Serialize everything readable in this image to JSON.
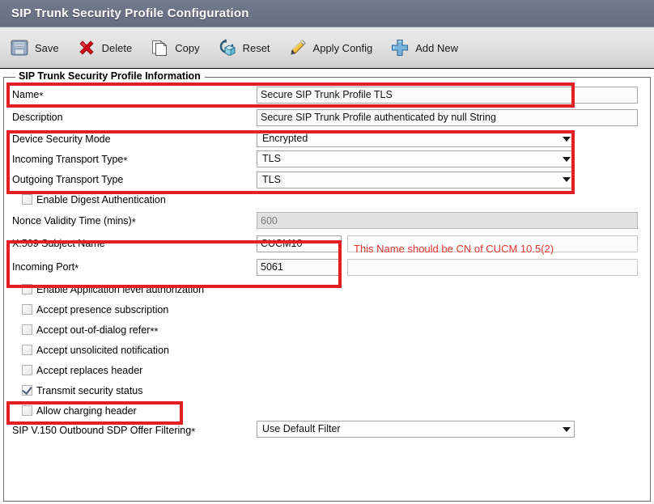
{
  "window": {
    "title": "SIP Trunk Security Profile Configuration",
    "titlebar_color": "#6b7487"
  },
  "toolbar": {
    "items": [
      {
        "label": "Save",
        "icon": "save-floppy-icon"
      },
      {
        "label": "Delete",
        "icon": "delete-x-icon"
      },
      {
        "label": "Copy",
        "icon": "copy-pages-icon"
      },
      {
        "label": "Reset",
        "icon": "reset-refresh-icon"
      },
      {
        "label": "Apply Config",
        "icon": "apply-config-pencil-icon"
      },
      {
        "label": "Add New",
        "icon": "add-new-plus-icon"
      }
    ]
  },
  "section": {
    "legend": "SIP Trunk Security Profile Information"
  },
  "fields": {
    "name": {
      "label": "Name",
      "required": "*",
      "value": "Secure SIP Trunk Profile TLS"
    },
    "description": {
      "label": "Description",
      "required": "",
      "value": "Secure SIP Trunk Profile authenticated by null String"
    },
    "device_security_mode": {
      "label": "Device Security Mode",
      "required": "",
      "value": "Encrypted"
    },
    "incoming_transport_type": {
      "label": "Incoming Transport Type",
      "required": "*",
      "value": "TLS"
    },
    "outgoing_transport_type": {
      "label": "Outgoing Transport Type",
      "required": "",
      "value": "TLS"
    },
    "nonce_validity_time": {
      "label": "Nonce Validity Time (mins)",
      "required": "*",
      "value": "600",
      "disabled": true
    },
    "x509_subject_name": {
      "label": "X.509 Subject Name",
      "required": "",
      "value": "CUCM10"
    },
    "incoming_port": {
      "label": "Incoming Port",
      "required": "*",
      "value": "5061"
    },
    "sip_v150_filtering": {
      "label": "SIP V.150 Outbound SDP Offer Filtering",
      "required": "*",
      "value": "Use Default Filter"
    }
  },
  "checkboxes": [
    {
      "label": "Enable Digest Authentication",
      "checked": false
    },
    {
      "label": "Enable Application level authorization",
      "checked": false
    },
    {
      "label": "Accept presence subscription",
      "checked": false
    },
    {
      "label": "Accept out-of-dialog refer",
      "suffix": "**",
      "checked": false
    },
    {
      "label": "Accept unsolicited notification",
      "checked": false
    },
    {
      "label": "Accept replaces header",
      "checked": false
    },
    {
      "label": "Transmit security status",
      "checked": true
    },
    {
      "label": "Allow charging header",
      "checked": false
    }
  ],
  "annotations": {
    "highlight_color": "#e31e24",
    "note_color": "#e0342f",
    "note_text": "This Name should be CN of CUCM 10.5(2)",
    "highlighted_regions": [
      "name-row",
      "transport-mode-group",
      "x509-and-port-group",
      "transmit-security-status-row"
    ]
  }
}
